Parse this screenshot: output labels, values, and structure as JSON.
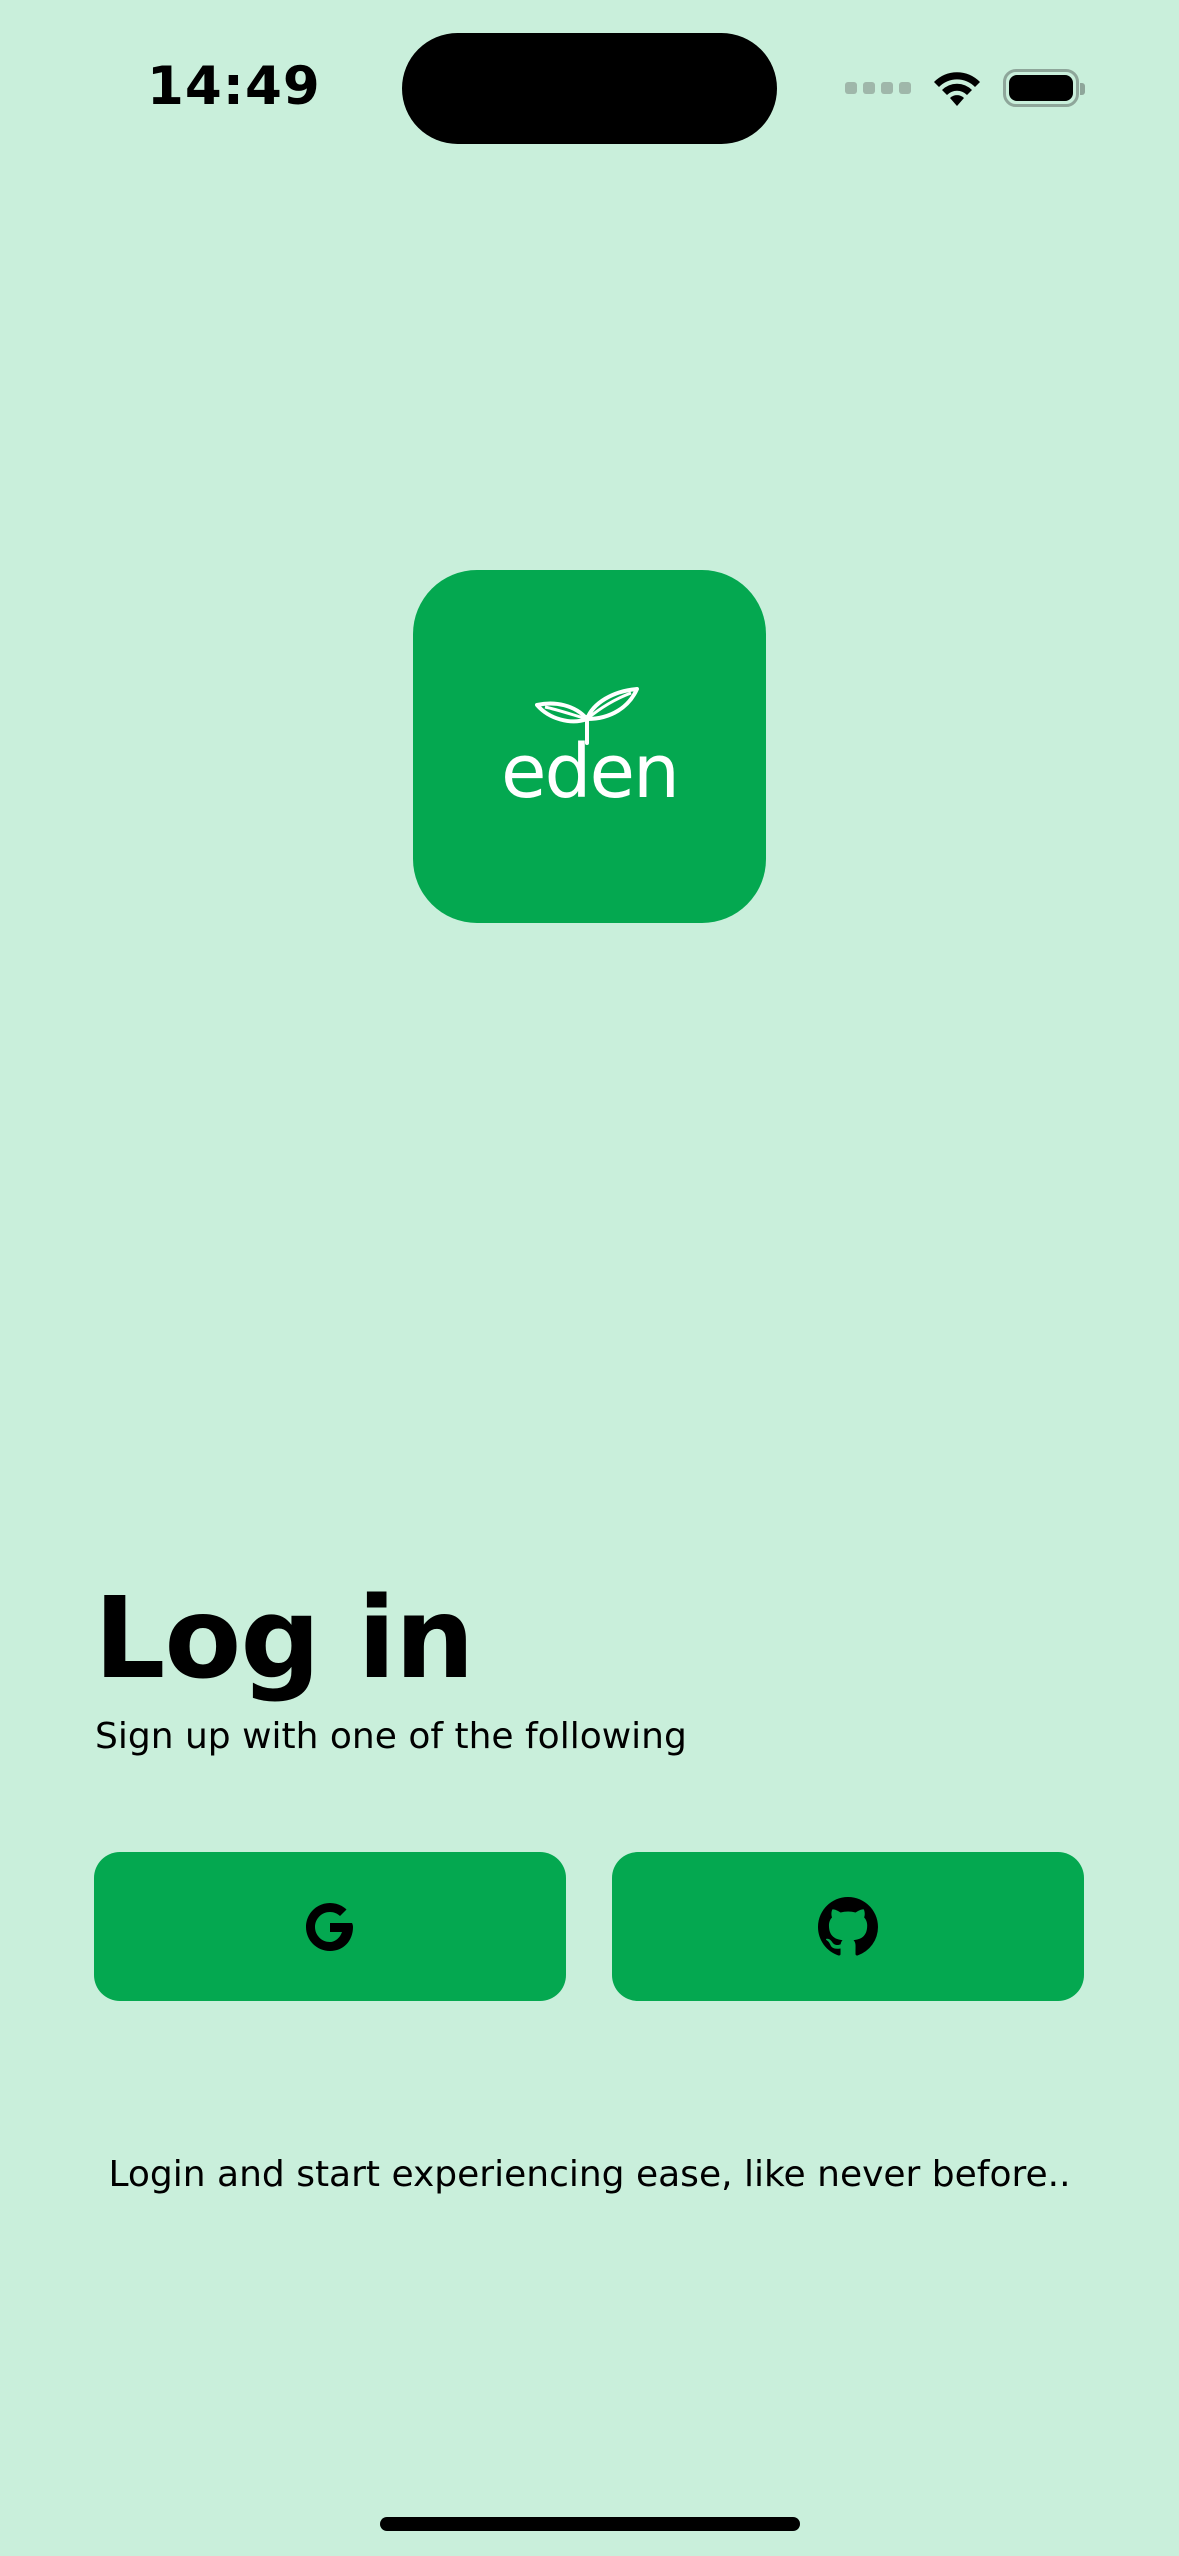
{
  "status_bar": {
    "time": "14:49",
    "icons": [
      "cellular-signal-icon",
      "wifi-icon",
      "battery-icon"
    ]
  },
  "logo": {
    "wordmark": "eden",
    "icon": "sprout-leaf-icon",
    "tile_color": "#04a850"
  },
  "login": {
    "title": "Log in",
    "subtitle": "Sign up with one of the following",
    "buttons": [
      {
        "provider": "Google",
        "icon": "google-icon"
      },
      {
        "provider": "GitHub",
        "icon": "github-icon"
      }
    ],
    "tagline": "Login and start experiencing ease, like never before.."
  },
  "colors": {
    "background": "#c9efdb",
    "accent": "#04a850"
  }
}
